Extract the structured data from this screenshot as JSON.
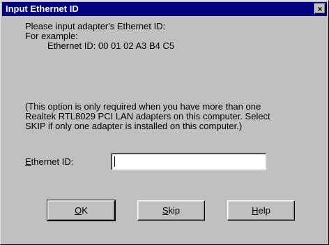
{
  "window": {
    "title": "Input Ethernet ID",
    "close_glyph": "×",
    "close_icon": "close-icon"
  },
  "instructions": {
    "line1": "Please input adapter's Ethernet ID:",
    "line2": "For example:",
    "example": "Ethernet ID: 00 01 02 A3 B4 C5",
    "note_line1": "(This option is only required when you have more than one",
    "note_line2": "Realtek RTL8029 PCI LAN adapters on this computer. Select",
    "note_line3": "SKIP if only one adapter is installed on this computer.)"
  },
  "field": {
    "label_mnemonic": "E",
    "label_rest": "thernet ID:",
    "value": ""
  },
  "buttons": {
    "ok": {
      "mnemonic": "O",
      "rest": "K"
    },
    "skip": {
      "mnemonic": "S",
      "rest": "kip"
    },
    "help": {
      "mnemonic": "H",
      "rest": "elp"
    }
  }
}
